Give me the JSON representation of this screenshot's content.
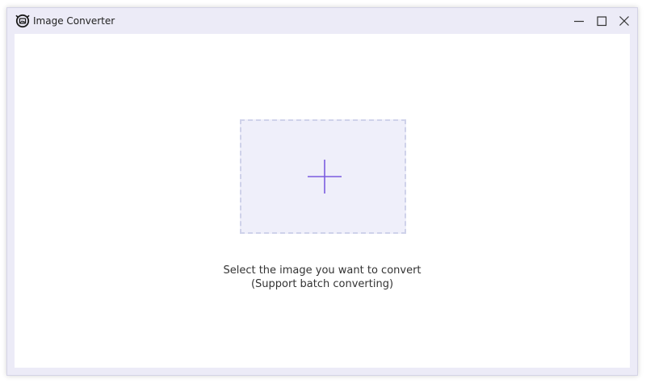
{
  "window": {
    "title": "Image Converter",
    "icons": {
      "app": "image-converter-logo-icon",
      "minimize": "minimize-icon",
      "maximize": "maximize-icon",
      "close": "close-icon"
    }
  },
  "main": {
    "dropzone_icon": "plus-icon",
    "prompt": "Select the image you want to convert",
    "subprompt": "(Support batch converting)"
  },
  "colors": {
    "accent": "#7b5ce0",
    "frame": "#ecebf7",
    "dropzone_fill": "#efeffa",
    "dropzone_border": "#cfd2ea"
  }
}
